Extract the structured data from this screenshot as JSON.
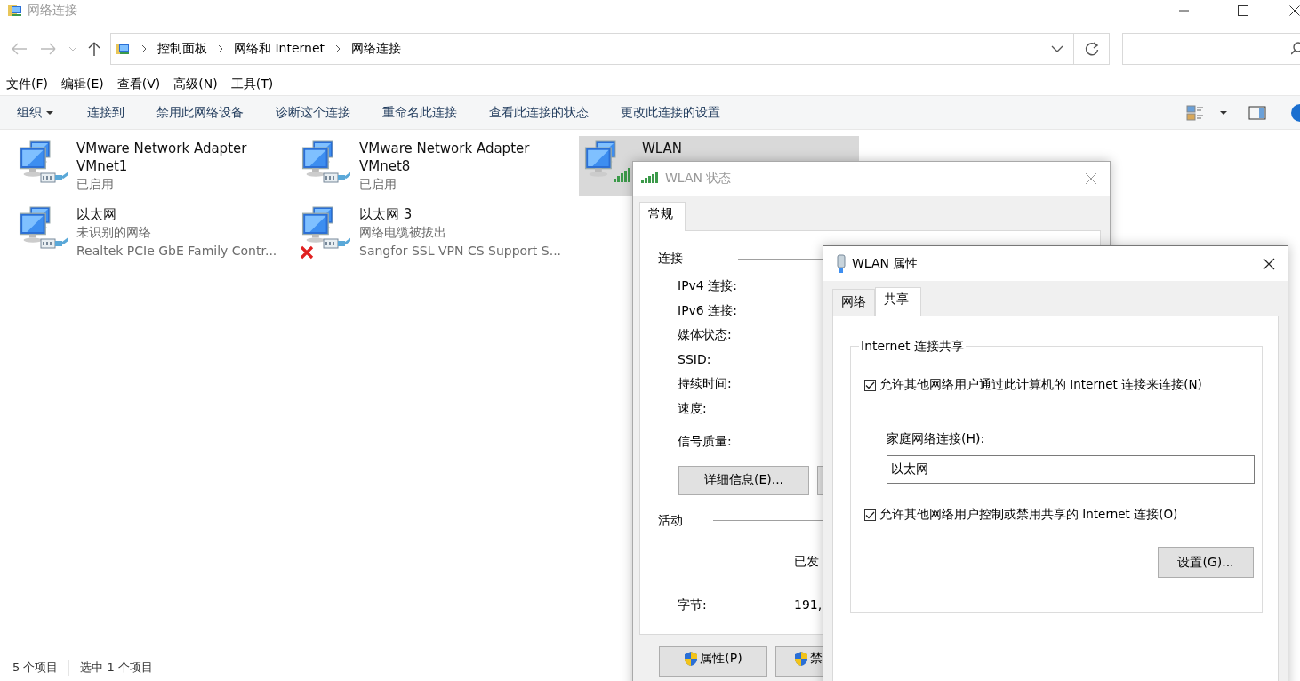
{
  "window": {
    "title": "网络连接"
  },
  "address": {
    "path": [
      "控制面板",
      "网络和 Internet",
      "网络连接"
    ]
  },
  "menu": [
    "文件(F)",
    "编辑(E)",
    "查看(V)",
    "高级(N)",
    "工具(T)"
  ],
  "commands": [
    {
      "label": "组织",
      "kind": "dropdown"
    },
    {
      "label": "连接到",
      "kind": "plain"
    },
    {
      "label": "禁用此网络设备",
      "kind": "plain"
    },
    {
      "label": "诊断这个连接",
      "kind": "plain"
    },
    {
      "label": "重命名此连接",
      "kind": "plain"
    },
    {
      "label": "查看此连接的状态",
      "kind": "plain"
    },
    {
      "label": "更改此连接的设置",
      "kind": "plain"
    }
  ],
  "adapters": [
    {
      "name": "VMware Network Adapter VMnet1",
      "status": "已启用",
      "kind": "wired",
      "disconnected": false,
      "selected": false
    },
    {
      "name": "VMware Network Adapter VMnet8",
      "status": "已启用",
      "kind": "wired",
      "disconnected": false,
      "selected": false
    },
    {
      "name": "WLAN",
      "kind": "wireless",
      "disconnected": false,
      "selected": true
    },
    {
      "name": "以太网",
      "status": "未识别的网络",
      "device": "Realtek PCIe GbE Family Contr...",
      "kind": "wired",
      "disconnected": false,
      "selected": false
    },
    {
      "name": "以太网 3",
      "status": "网络电缆被拔出",
      "device": "Sangfor SSL VPN CS Support S...",
      "kind": "wired",
      "disconnected": true,
      "selected": false
    }
  ],
  "status_bar": {
    "count": "5 个项目",
    "selection": "选中 1 个项目"
  },
  "status_dialog": {
    "title": "WLAN 状态",
    "tabs": [
      {
        "label": "常规",
        "selected": true
      }
    ],
    "connection_group": "连接",
    "fields": [
      "IPv4 连接:",
      "IPv6 连接:",
      "媒体状态:",
      "SSID:",
      "持续时间:",
      "速度:"
    ],
    "signal_label": "信号质量:",
    "details_button": "详细信息(E)...",
    "activity_group": "活动",
    "sent_heading": "已发",
    "bytes_label": "字节:",
    "bytes_sent": "191,",
    "buttons": [
      {
        "label": "属性(P)"
      },
      {
        "label": "禁"
      }
    ]
  },
  "properties_dialog": {
    "title": "WLAN 属性",
    "tabs": [
      {
        "label": "网络",
        "selected": false
      },
      {
        "label": "共享",
        "selected": true
      }
    ],
    "group": "Internet 连接共享",
    "share_option": {
      "label": "允许其他网络用户通过此计算机的 Internet 连接来连接(N)",
      "checked": true
    },
    "home_label": "家庭网络连接(H):",
    "home_value": "以太网",
    "control_option": {
      "label": "允许其他网络用户控制或禁用共享的 Internet 连接(O)",
      "checked": true
    },
    "settings_button": "设置(G)..."
  }
}
